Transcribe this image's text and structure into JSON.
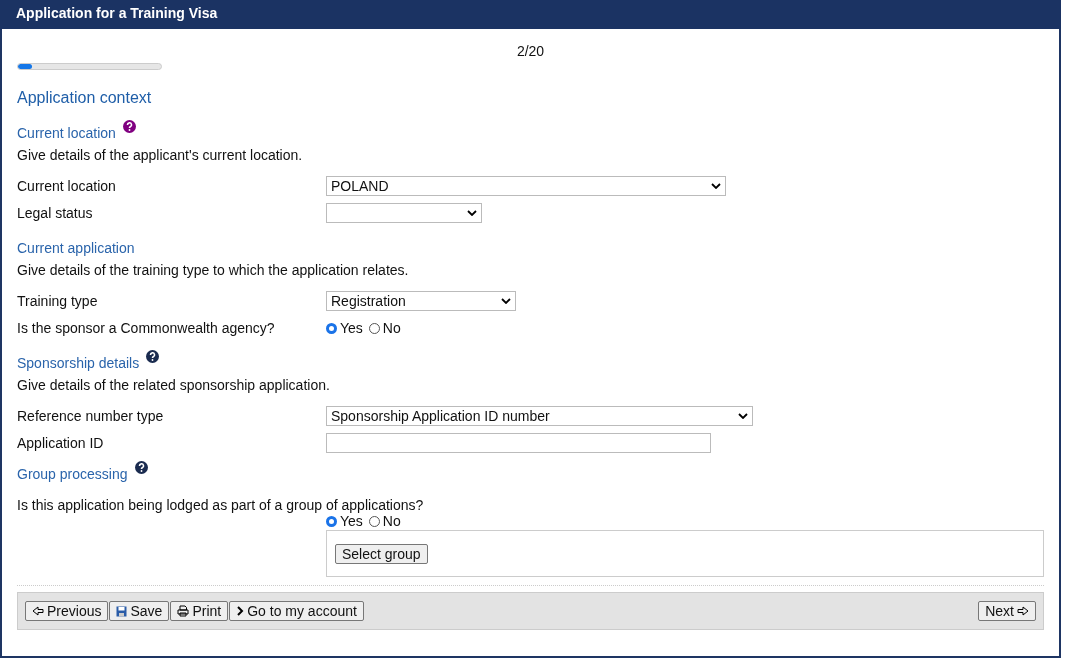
{
  "window": {
    "title": "Application for a Training Visa"
  },
  "progress": {
    "step": "2/20",
    "level": 0.1
  },
  "page_heading": "Application context",
  "sections": [
    {
      "heading": "Current location",
      "help": true,
      "color": "#800080",
      "description": "Give details of the applicant's current location.",
      "fields": [
        {
          "kind": "select",
          "label": "Current location",
          "value": "POLAND"
        },
        {
          "kind": "select",
          "label": "Legal status"
        }
      ]
    },
    {
      "heading": "Current application",
      "help": false,
      "description": "Give details of the training type to which the application relates.",
      "fields": [
        {
          "kind": "select",
          "label": "Training type",
          "value": "Registration"
        },
        {
          "kind": "radio",
          "label": "Is the sponsor a Commonwealth agency?",
          "options": [
            {
              "label": "Yes",
              "selected": true
            },
            {
              "label": "No",
              "selected": false
            }
          ]
        }
      ]
    },
    {
      "heading": "Sponsorship details",
      "help": true,
      "color": "#1a2b4f",
      "description": "Give details of the related sponsorship application.",
      "fields": [
        {
          "kind": "select",
          "label": "Reference number type",
          "value": "Sponsorship Application ID number"
        },
        {
          "kind": "text",
          "label": "Application ID"
        }
      ]
    }
  ],
  "group": {
    "heading": "Group processing",
    "help": true,
    "color": "#1a2b4f",
    "question": "Is this application being lodged as part of a group of applications?",
    "options": [
      {
        "label": "Yes",
        "selected": true
      },
      {
        "label": "No",
        "selected": false
      }
    ],
    "button": "Select group"
  },
  "footer": {
    "buttons": [
      {
        "label": "Previous"
      },
      {
        "label": "Save"
      },
      {
        "label": "Print"
      },
      {
        "label": "Go to my account"
      }
    ],
    "next": {
      "label": "Next"
    }
  }
}
